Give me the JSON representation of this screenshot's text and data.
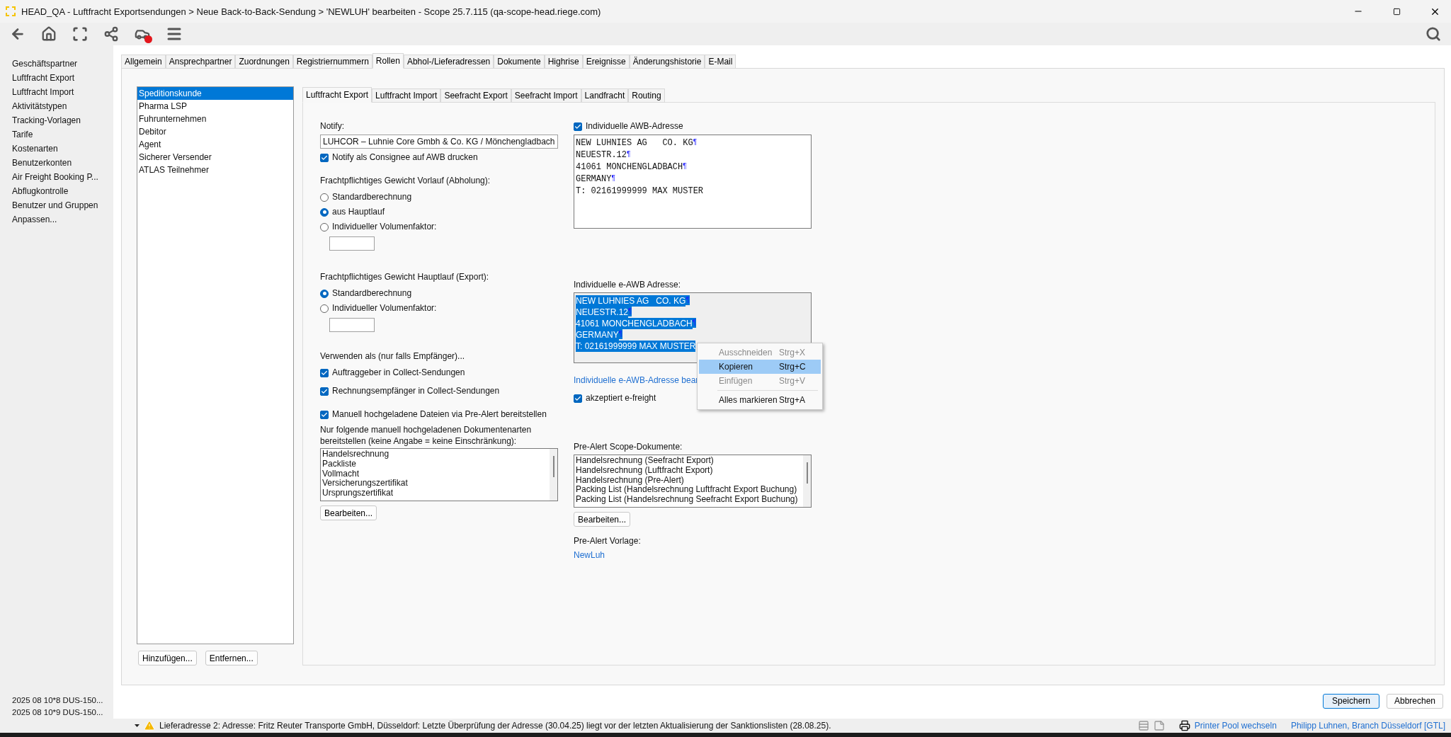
{
  "window": {
    "title": "HEAD_QA - Luftfracht Exportsendungen > Neue Back-to-Back-Sendung > 'NEWLUH' bearbeiten - Scope 25.7.115 (qa-scope-head.riege.com)"
  },
  "sidebar": {
    "items": [
      "Geschäftspartner",
      "Luftfracht Export",
      "Luftfracht Import",
      "Aktivitätstypen",
      "Tracking-Vorlagen",
      "Tarife",
      "Kostenarten",
      "Benutzerkonten",
      "Air Freight Booking P...",
      "Abflugkontrolle",
      "Benutzer und Gruppen",
      "Anpassen..."
    ],
    "recent": [
      "2025 08 10*8 DUS-150...",
      "2025 08 10*9 DUS-150..."
    ]
  },
  "tabs": [
    {
      "label": "Allgemein",
      "selected": false
    },
    {
      "label": "Ansprechpartner",
      "selected": false
    },
    {
      "label": "Zuordnungen",
      "selected": false
    },
    {
      "label": "Registriernummern",
      "selected": false
    },
    {
      "label": "Rollen",
      "selected": true
    },
    {
      "label": "Abhol-/Lieferadressen",
      "selected": false
    },
    {
      "label": "Dokumente",
      "selected": false
    },
    {
      "label": "Highrise",
      "selected": false
    },
    {
      "label": "Ereignisse",
      "selected": false
    },
    {
      "label": "Änderungshistorie",
      "selected": false
    },
    {
      "label": "E-Mail",
      "selected": false
    }
  ],
  "roles": {
    "items": [
      {
        "label": "Speditionskunde",
        "selected": true
      },
      {
        "label": "Pharma LSP",
        "selected": false
      },
      {
        "label": "Fuhrunternehmen",
        "selected": false
      },
      {
        "label": "Debitor",
        "selected": false
      },
      {
        "label": "Agent",
        "selected": false
      },
      {
        "label": "Sicherer Versender",
        "selected": false
      },
      {
        "label": "ATLAS Teilnehmer",
        "selected": false
      }
    ],
    "buttons": [
      "Hinzufügen...",
      "Entfernen..."
    ]
  },
  "subtabs": [
    {
      "label": "Luftfracht Export",
      "selected": true
    },
    {
      "label": "Luftfracht Import",
      "selected": false
    },
    {
      "label": "Seefracht Export",
      "selected": false
    },
    {
      "label": "Seefracht Import",
      "selected": false
    },
    {
      "label": "Landfracht",
      "selected": false
    },
    {
      "label": "Routing",
      "selected": false
    }
  ],
  "left": {
    "notify_label": "Notify:",
    "notify_value": "LUHCOR – Luhnie Core Gmbh & Co. KG / Mönchengladbach",
    "notify_print": {
      "label": "Notify als Consignee auf AWB drucken",
      "checked": true
    },
    "vorlauf_label": "Frachtpflichtiges Gewicht Vorlauf (Abholung):",
    "vorlauf_options": [
      {
        "label": "Standardberechnung",
        "selected": false
      },
      {
        "label": "aus Hauptlauf",
        "selected": true
      },
      {
        "label": "Individueller Volumenfaktor:",
        "selected": false
      }
    ],
    "hauptlauf_label": "Frachtpflichtiges Gewicht Hauptlauf (Export):",
    "hauptlauf_options": [
      {
        "label": "Standardberechnung",
        "selected": true
      },
      {
        "label": "Individueller Volumenfaktor:",
        "selected": false
      }
    ],
    "use_as_label": "Verwenden als (nur falls Empfänger)...",
    "use_as": [
      {
        "label": "Auftraggeber in Collect-Sendungen",
        "checked": true
      },
      {
        "label": "Rechnungsempfänger in Collect-Sendungen",
        "checked": true
      }
    ],
    "manual_upload": {
      "label": "Manuell hochgeladene Dateien via Pre-Alert bereitstellen",
      "checked": true
    },
    "doc_types_label": "Nur folgende manuell hochgeladenen Dokumentenarten bereitstellen (keine Angabe = keine Einschränkung):",
    "doc_types": [
      "Handelsrechnung",
      "Packliste",
      "Vollmacht",
      "Versicherungszertifikat",
      "Ursprungszertifikat"
    ],
    "edit_button": "Bearbeiten..."
  },
  "right": {
    "awb_address": {
      "label": "Individuelle AWB-Adresse",
      "checked": true
    },
    "awb_lines": [
      {
        "text": "NEW LUHNIES AG   CO. KG",
        "mark": "¶"
      },
      {
        "text": "NEUESTR.12",
        "mark": "¶"
      },
      {
        "text": "41061 MONCHENGLADBACH",
        "mark": "¶"
      },
      {
        "text": "GERMANY",
        "mark": "¶"
      },
      {
        "text": "T: 02161999999 MAX MUSTER"
      }
    ],
    "eawb_label": "Individuelle e-AWB Adresse:",
    "eawb_lines": [
      {
        "text": "NEW LUHNIES AG   CO. KG",
        "mark": "¶"
      },
      {
        "text": "NEUESTR.12",
        "mark": "¶"
      },
      {
        "text": "41061 MONCHENGLADBACH",
        "mark": "¶"
      },
      {
        "text": "GERMANY",
        "mark": "¶"
      },
      {
        "text": "T: 02161999999 MAX MUSTER"
      }
    ],
    "eawb_link": "Individuelle e-AWB-Adresse bear",
    "efreight": {
      "label": "akzeptiert e-freight",
      "checked": true
    },
    "docs_label": "Pre-Alert Scope-Dokumente:",
    "docs": [
      "Handelsrechnung (Seefracht Export)",
      "Handelsrechnung (Luftfracht Export)",
      "Handelsrechnung (Pre-Alert)",
      "Packing List (Handelsrechnung Luftfracht Export Buchung)",
      "Packing List (Handelsrechnung Seefracht Export Buchung)"
    ],
    "edit_button": "Bearbeiten...",
    "template_label": "Pre-Alert Vorlage:",
    "template_link": "NewLuh"
  },
  "context_menu": [
    {
      "kind": "item",
      "label": "Ausschneiden",
      "shortcut": "Strg+X",
      "disabled": true,
      "selected": false
    },
    {
      "kind": "item",
      "label": "Kopieren",
      "shortcut": "Strg+C",
      "disabled": false,
      "selected": true
    },
    {
      "kind": "item",
      "label": "Einfügen",
      "shortcut": "Strg+V",
      "disabled": true,
      "selected": false
    },
    {
      "kind": "separator"
    },
    {
      "kind": "item",
      "label": "Alles markieren",
      "shortcut": "Strg+A",
      "disabled": false,
      "selected": false
    }
  ],
  "footer_buttons": [
    {
      "label": "Speichern",
      "primary": true
    },
    {
      "label": "Abbrechen",
      "primary": false
    }
  ],
  "status_bar": {
    "message": "Lieferadresse 2: Adresse: Fritz Reuter Transporte GmbH, Düsseldorf: Letzte Überprüfung der Adresse (30.04.25) liegt vor der letzten Aktualisierung der Sanktionslisten (28.08.25).",
    "printer_link": "Printer Pool wechseln",
    "user_link": "Philipp Luhnen, Branch Düsseldorf [GTL]"
  }
}
